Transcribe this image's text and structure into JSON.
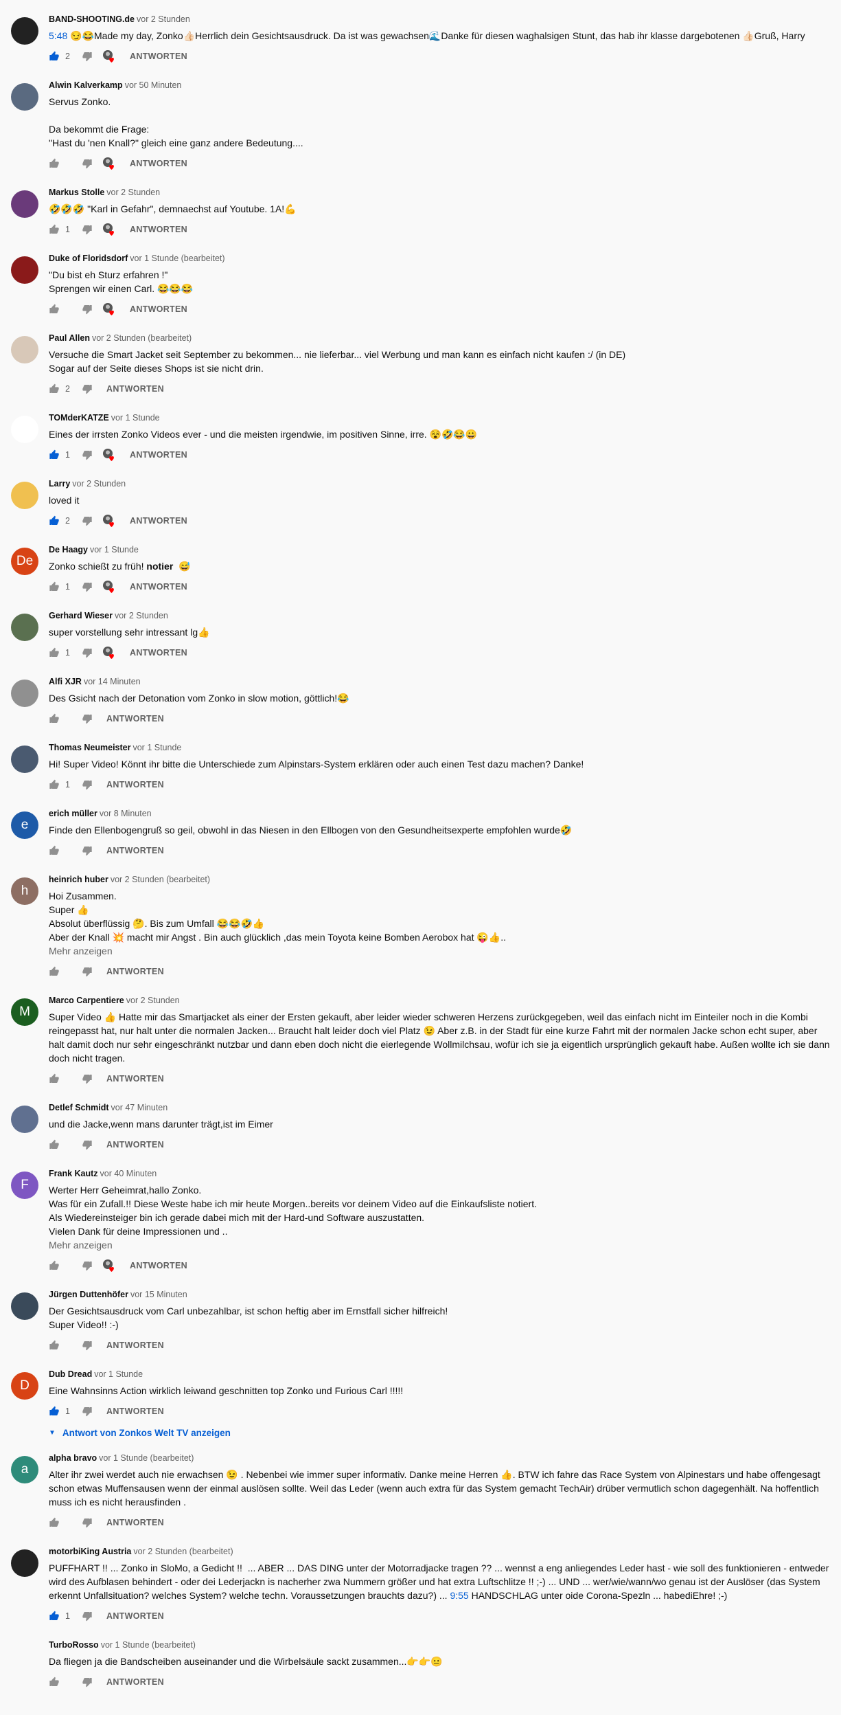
{
  "reply_label": "ANTWORTEN",
  "colors": {
    "link": "#065fd4",
    "like_active": "#065fd4",
    "muted": "#606060",
    "heart": "#ff0000"
  },
  "comments": [
    {
      "author": "BAND-SHOOTING.de",
      "time": "vor 2 Stunden",
      "timestamp_link": "5:48",
      "text": " 😏😂Made my day, Zonko👍🏻Herrlich dein Gesichtsausdruck. Da ist was gewachsen🌊Danke für diesen waghalsigen Stunt, das hab ihr klasse dargebotenen 👍🏻Gruß, Harry",
      "likes": "2",
      "liked": true,
      "hearted": true,
      "avatar_color": "#222222",
      "avatar_letter": ""
    },
    {
      "author": "Alwin Kalverkamp",
      "time": "vor 50 Minuten",
      "text": "Servus Zonko.\n\nDa bekommt die Frage:\n\"Hast du 'nen Knall?\" gleich eine ganz andere Bedeutung....",
      "likes": "",
      "liked": false,
      "hearted": true,
      "avatar_color": "#5a6a80",
      "avatar_letter": ""
    },
    {
      "author": "Markus Stolle",
      "time": "vor 2 Stunden",
      "text": "🤣🤣🤣 \"Karl in Gefahr\", demnaechst auf Youtube. 1A!💪",
      "likes": "1",
      "liked": false,
      "hearted": true,
      "avatar_color": "#6a3a7a",
      "avatar_letter": ""
    },
    {
      "author": "Duke of Floridsdorf",
      "time": "vor 1 Stunde (bearbeitet)",
      "text": "\"Du bist eh Sturz erfahren !\"\nSprengen wir einen Carl. 😂😂😂",
      "likes": "",
      "liked": false,
      "hearted": true,
      "avatar_color": "#8a1a1a",
      "avatar_letter": ""
    },
    {
      "author": "Paul Allen",
      "time": "vor 2 Stunden (bearbeitet)",
      "text": "Versuche die Smart Jacket seit September zu bekommen... nie lieferbar... viel Werbung und man kann es einfach nicht kaufen :/ (in DE)\nSogar auf der Seite dieses Shops ist sie nicht drin.",
      "likes": "2",
      "liked": false,
      "hearted": false,
      "avatar_color": "#d8c8b8",
      "avatar_letter": ""
    },
    {
      "author": "TOMderKATZE",
      "time": "vor 1 Stunde",
      "text": "Eines der irrsten Zonko Videos ever - und die meisten irgendwie, im positiven Sinne, irre. 😵🤣😂😀",
      "likes": "1",
      "liked": true,
      "hearted": true,
      "avatar_color": "#ffffff",
      "avatar_letter": ""
    },
    {
      "author": "Larry",
      "time": "vor 2 Stunden",
      "text": "loved it",
      "likes": "2",
      "liked": true,
      "hearted": true,
      "avatar_color": "#f0c050",
      "avatar_letter": ""
    },
    {
      "author": "De Haagy",
      "time": "vor 1 Stunde",
      "text": "Zonko schießt zu früh! *notier*  😅",
      "likes": "1",
      "liked": false,
      "hearted": true,
      "avatar_color": "#d84315",
      "avatar_letter": "De"
    },
    {
      "author": "Gerhard Wieser",
      "time": "vor 2 Stunden",
      "text": "super vorstellung sehr intressant lg👍",
      "likes": "1",
      "liked": false,
      "hearted": true,
      "avatar_color": "#5a7050",
      "avatar_letter": ""
    },
    {
      "author": "Alfi XJR",
      "time": "vor 14 Minuten",
      "text": "Des Gsicht nach der Detonation vom Zonko in slow motion, göttlich!😂",
      "likes": "",
      "liked": false,
      "hearted": false,
      "avatar_color": "#909090",
      "avatar_letter": ""
    },
    {
      "author": "Thomas Neumeister",
      "time": "vor 1 Stunde",
      "text": "Hi! Super Video! Könnt ihr bitte die Unterschiede zum Alpinstars-System erklären oder auch einen Test dazu machen? Danke!",
      "likes": "1",
      "liked": false,
      "hearted": false,
      "avatar_color": "#4a5a70",
      "avatar_letter": ""
    },
    {
      "author": "erich müller",
      "time": "vor 8 Minuten",
      "text": "Finde den Ellenbogengruß so geil, obwohl in das Niesen in den Ellbogen von den Gesundheitsexperte empfohlen wurde🤣",
      "likes": "",
      "liked": false,
      "hearted": false,
      "avatar_color": "#1e5ba8",
      "avatar_letter": "e"
    },
    {
      "author": "heinrich huber",
      "time": "vor 2 Stunden (bearbeitet)",
      "text": "Hoi Zusammen.\nSuper 👍\nAbsolut überflüssig 🤔. Bis zum Umfall 😂😂🤣👍\nAber der Knall 💥 macht mir Angst . Bin auch glücklich ,das mein Toyota keine Bomben Aerobox hat 😜👍..",
      "more": "Mehr anzeigen",
      "likes": "",
      "liked": false,
      "hearted": false,
      "avatar_color": "#8d6e63",
      "avatar_letter": "h"
    },
    {
      "author": "Marco Carpentiere",
      "time": "vor 2 Stunden",
      "text": "Super Video 👍 Hatte mir das Smartjacket als einer der Ersten gekauft, aber leider wieder schweren Herzens zurückgegeben, weil das einfach nicht im Einteiler noch in die Kombi reingepasst hat, nur halt unter die normalen Jacken... Braucht halt leider doch viel Platz 😉 Aber z.B. in der Stadt für eine kurze Fahrt mit der normalen Jacke schon echt super, aber halt damit doch nur sehr eingeschränkt nutzbar und dann eben doch nicht die eierlegende Wollmilchsau, wofür ich sie ja eigentlich ursprünglich gekauft habe. Außen wollte ich sie dann doch nicht tragen.",
      "likes": "",
      "liked": false,
      "hearted": false,
      "avatar_color": "#1b5e20",
      "avatar_letter": "M"
    },
    {
      "author": "Detlef Schmidt",
      "time": "vor 47 Minuten",
      "text": "und die Jacke,wenn mans darunter trägt,ist im Eimer",
      "likes": "",
      "liked": false,
      "hearted": false,
      "avatar_color": "#607090",
      "avatar_letter": ""
    },
    {
      "author": "Frank Kautz",
      "time": "vor 40 Minuten",
      "text": "Werter Herr Geheimrat,hallo Zonko.\nWas für ein Zufall.!! Diese Weste habe ich mir heute Morgen..bereits vor deinem Video auf die Einkaufsliste notiert.\nAls Wiedereinsteiger bin ich gerade dabei mich mit der Hard-und Software auszustatten.\nVielen Dank für deine Impressionen und ..",
      "more": "Mehr anzeigen",
      "likes": "",
      "liked": false,
      "hearted": true,
      "avatar_color": "#7e57c2",
      "avatar_letter": "F"
    },
    {
      "author": "Jürgen Duttenhöfer",
      "time": "vor 15 Minuten",
      "text": "Der Gesichtsausdruck vom Carl unbezahlbar, ist schon heftig aber im Ernstfall sicher hilfreich!\nSuper Video!! :-)",
      "likes": "",
      "liked": false,
      "hearted": false,
      "avatar_color": "#3a4a5a",
      "avatar_letter": ""
    },
    {
      "author": "Dub Dread",
      "time": "vor 1 Stunde",
      "text": "Eine Wahnsinns Action wirklich leiwand geschnitten top Zonko und Furious Carl !!!!!",
      "likes": "1",
      "liked": true,
      "hearted": false,
      "avatar_color": "#d84315",
      "avatar_letter": "D",
      "replies": "Antwort von Zonkos Welt TV anzeigen"
    },
    {
      "author": "alpha bravo",
      "time": "vor 1 Stunde (bearbeitet)",
      "text": "Alter ihr zwei werdet auch nie erwachsen 😉 . Nebenbei wie immer super informativ. Danke meine Herren 👍. BTW ich fahre das Race System von Alpinestars und habe offengesagt schon etwas Muffensausen wenn der einmal auslösen sollte. Weil das Leder (wenn auch extra für das System gemacht TechAir) drüber vermutlich schon dagegenhält. Na hoffentlich muss ich es nicht herausfinden .",
      "likes": "",
      "liked": false,
      "hearted": false,
      "avatar_color": "#2e8b7a",
      "avatar_letter": "a"
    },
    {
      "author": "motorbiKing Austria",
      "time": "vor 2 Stunden (bearbeitet)",
      "text": "PUFFHART !! ... Zonko in SloMo, a Gedicht !!  ... ABER ... DAS DING unter der Motorradjacke tragen ?? ... wennst a eng anliegendes Leder hast - wie soll des funktionieren - entweder wird des Aufblasen behindert - oder dei Lederjackn is nacherher zwa Nummern größer und hat extra Luftschlitze !! ;-) ... UND ... wer/wie/wann/wo genau ist der Auslöser (das System erkennt Unfallsituation? welches System? welche techn. Voraussetzungen brauchts dazu?) ... ",
      "timestamp_link2": "9:55",
      "text_after": " HANDSCHLAG unter oide Corona-Spezln ... habediEhre! ;-)",
      "likes": "1",
      "liked": true,
      "hearted": false,
      "avatar_color": "#222222",
      "avatar_letter": ""
    },
    {
      "author": "TurboRosso",
      "time": "vor 1 Stunde (bearbeitet)",
      "text": "Da fliegen ja die Bandscheiben auseinander und die Wirbelsäule sackt zusammen...👉👉😐",
      "likes": "",
      "liked": false,
      "hearted": false,
      "avatar_color": "",
      "avatar_letter": ""
    }
  ]
}
